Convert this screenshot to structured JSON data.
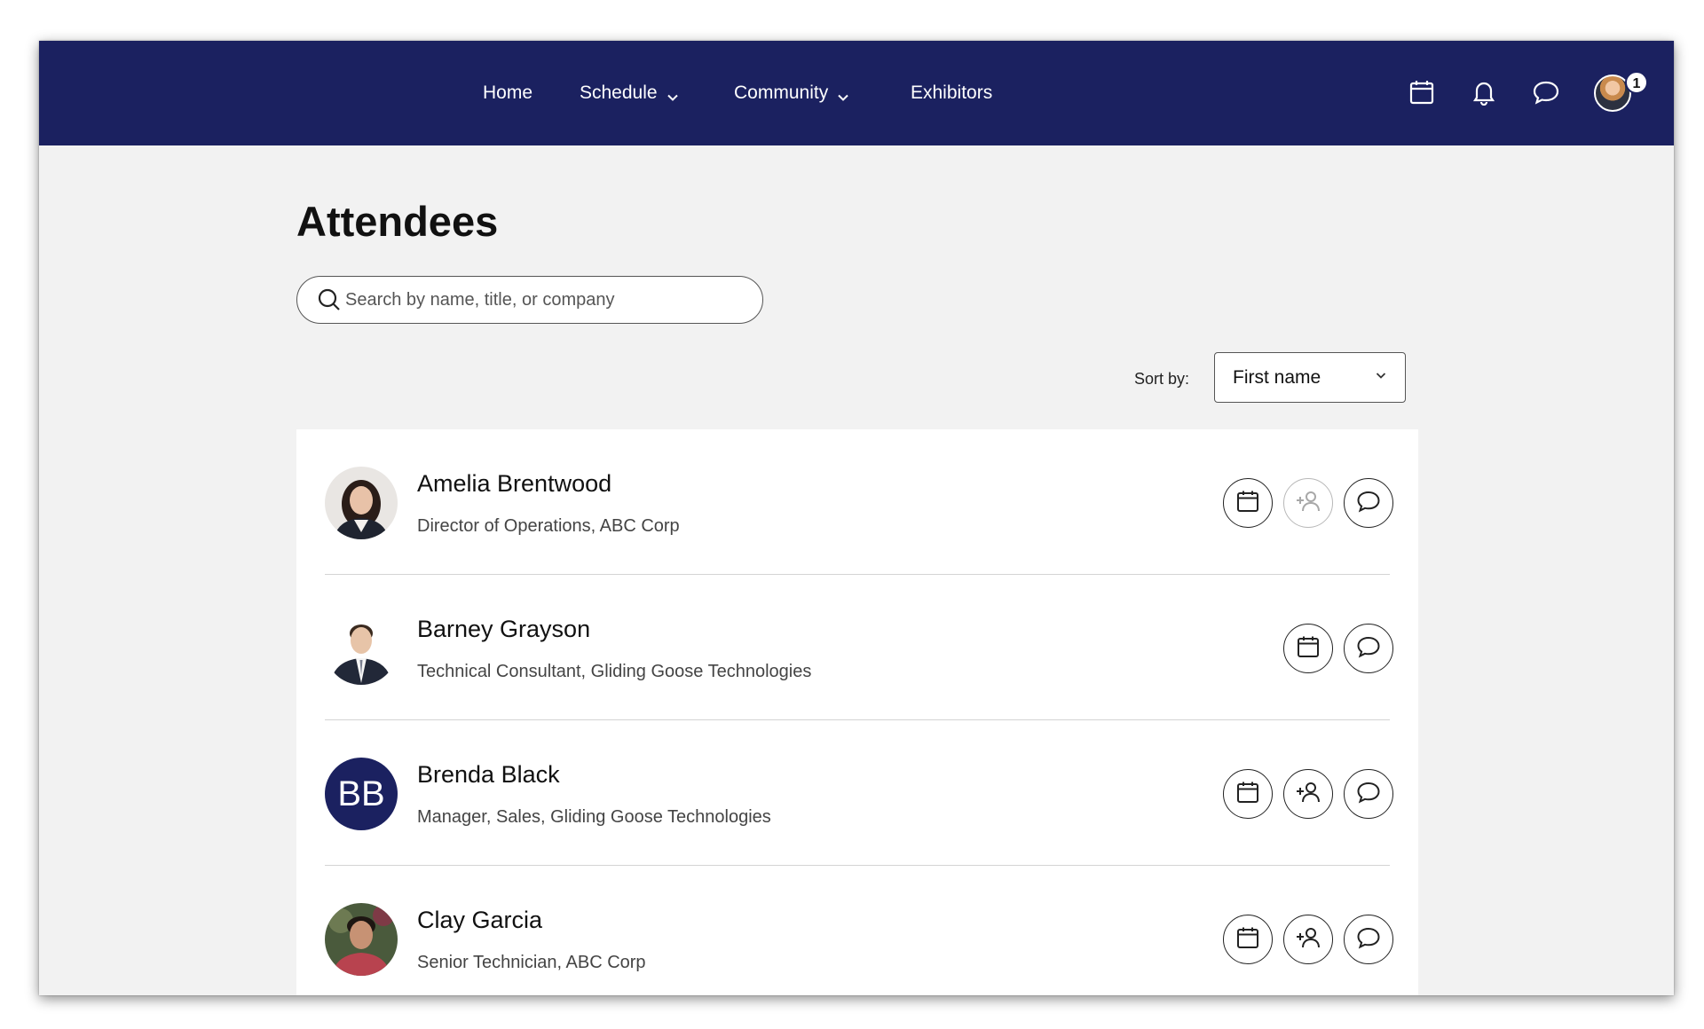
{
  "nav": {
    "links": [
      {
        "label": "Home"
      },
      {
        "label": "Schedule"
      },
      {
        "label": "Community"
      },
      {
        "label": "Exhibitors"
      }
    ],
    "icons": [
      "calendar-icon",
      "bell-icon",
      "chat-icon"
    ],
    "notification_count": "1"
  },
  "page": {
    "title": "Attendees",
    "search_placeholder": "Search by name, title, or company"
  },
  "sort": {
    "label": "Sort by:",
    "selected": "First name"
  },
  "attendees": [
    {
      "name": "Amelia Brentwood",
      "title": "Director of Operations, ABC Corp",
      "avatar": "photo",
      "actions": [
        "schedule",
        "connect-disabled",
        "message"
      ]
    },
    {
      "name": "Barney Grayson",
      "title": "Technical Consultant, Gliding Goose Technologies",
      "avatar": "photo",
      "actions": [
        "schedule",
        "message"
      ]
    },
    {
      "name": "Brenda Black",
      "title": "Manager, Sales, Gliding Goose Technologies",
      "avatar": "initials",
      "initials": "BB",
      "actions": [
        "schedule",
        "connect",
        "message"
      ]
    },
    {
      "name": "Clay Garcia",
      "title": "Senior Technician, ABC Corp",
      "avatar": "photo",
      "actions": [
        "schedule",
        "connect",
        "message"
      ]
    }
  ],
  "colors": {
    "nav_bg": "#1b2160",
    "page_bg": "#f2f2f2",
    "card_bg": "#ffffff",
    "initials_avatar": "#1b2160"
  }
}
